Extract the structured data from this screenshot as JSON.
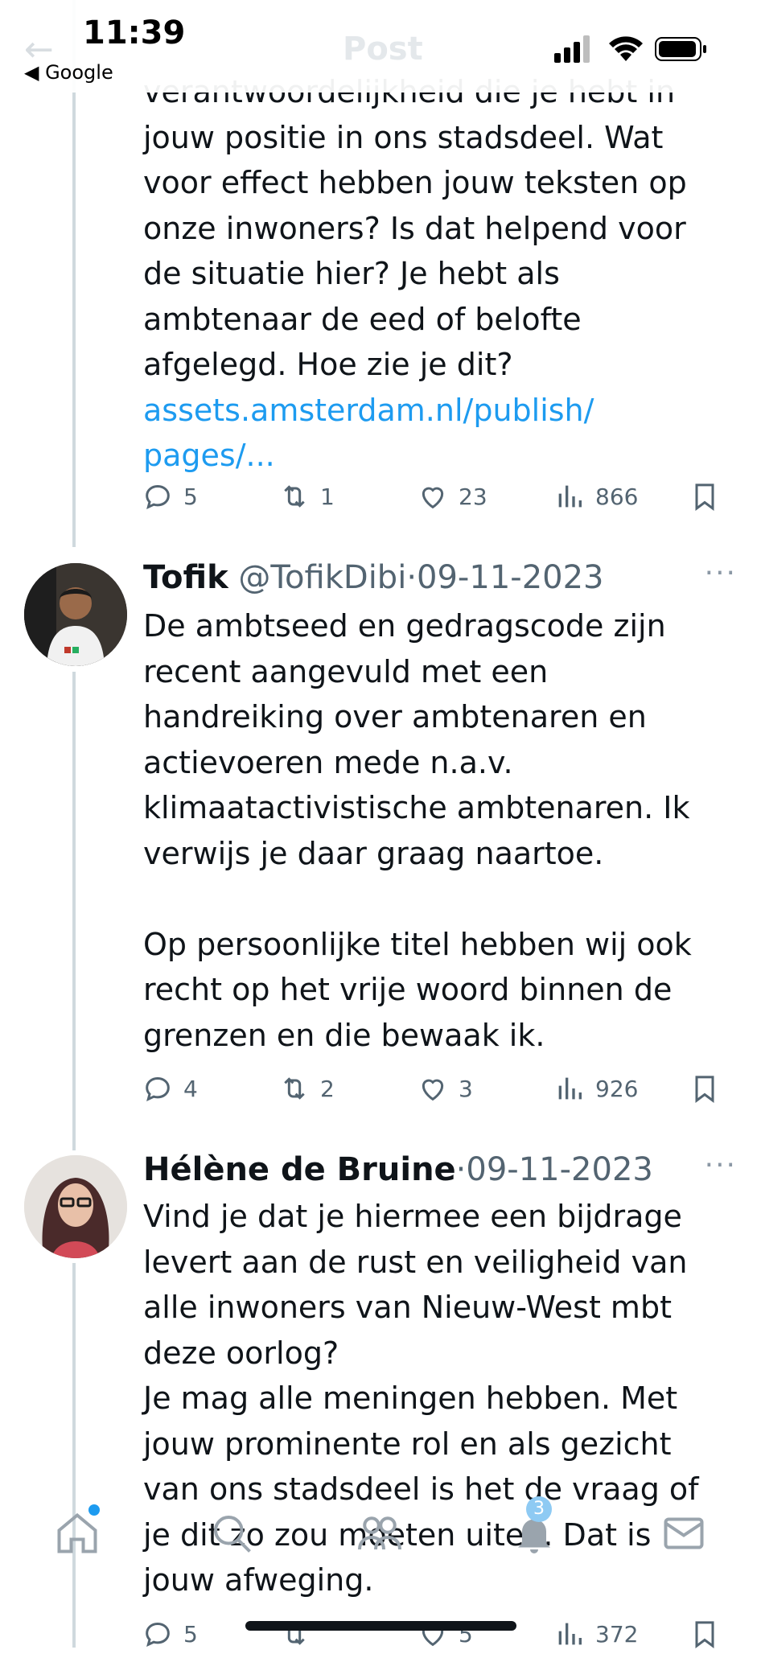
{
  "status_bar": {
    "time": "11:39",
    "back_app": "◀ Google"
  },
  "header": {
    "title": "Post"
  },
  "tweet1": {
    "hidden_top_line": "verantwoordelijkheid die je hebt in",
    "text_lines": [
      "jouw positie in ons stadsdeel. Wat",
      "voor effect hebben jouw teksten op",
      "onze inwoners? Is dat helpend voor",
      "de situatie hier? Je hebt als",
      "ambtenaar de eed of belofte",
      "afgelegd. Hoe zie je dit?"
    ],
    "link_lines": [
      "assets.amsterdam.nl/publish/",
      "pages/..."
    ],
    "actions": {
      "replies": "5",
      "reposts": "1",
      "likes": "23",
      "views": "866"
    }
  },
  "tweet2": {
    "name": "Tofik",
    "handle": "@TofikDibi",
    "sep": "·",
    "date": "09-11-2023",
    "more": "···",
    "text_lines": [
      "De ambtseed en gedragscode zijn",
      "recent aangevuld met een",
      "handreiking over ambtenaren en",
      "actievoeren mede n.a.v.",
      "klimaatactivistische ambtenaren. Ik",
      "verwijs je daar graag naartoe.",
      "",
      "Op persoonlijke titel hebben wij ook",
      "recht op het vrije woord binnen de",
      "grenzen en die bewaak ik."
    ],
    "actions": {
      "replies": "4",
      "reposts": "2",
      "likes": "3",
      "views": "926"
    }
  },
  "tweet3": {
    "name": "Hélène de Bruine",
    "sep": "·",
    "date": "09-11-2023",
    "more": "···",
    "text_lines": [
      "Vind je dat je hiermee een bijdrage",
      "levert aan de rust en veiligheid van",
      "alle inwoners van Nieuw-West mbt",
      "deze oorlog?",
      "Je mag alle meningen hebben. Met",
      "jouw prominente rol en als gezicht",
      "van ons stadsdeel is het de vraag of",
      "je dit zo zou moeten uiten. Dat is",
      "jouw afweging."
    ],
    "actions": {
      "replies": "5",
      "likes": "5",
      "views": "372"
    }
  },
  "bottom_nav": {
    "notifications_badge": "3"
  },
  "colors": {
    "link": "#1d9bf0",
    "muted": "#536471",
    "text": "#0f1419"
  }
}
